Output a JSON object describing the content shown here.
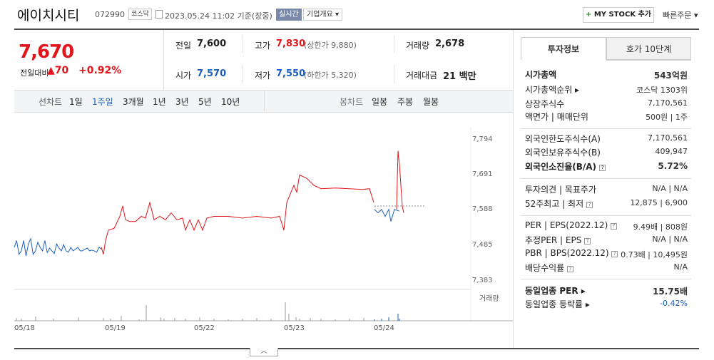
{
  "header": {
    "company_name": "에이치시티",
    "code": "072990",
    "market": "코스닥",
    "datetime": "2023.05.24 11:02 기준(장중)",
    "live_label": "실시간",
    "corp_overview": "기업개요 ▾",
    "mystock_plus": "+",
    "mystock_label": "MY STOCK 추가",
    "quick_order": "빠른주문 ▾"
  },
  "price": {
    "current": "7,670",
    "change_label": "전일대비",
    "change_arrow": "▲",
    "change": "70",
    "change_pct": "+0.92%"
  },
  "stats": {
    "prev_label": "전일",
    "prev": "7,600",
    "high_label": "고가",
    "high": "7,830",
    "upper_limit": "(상한가 9,880)",
    "volume_label": "거래량",
    "volume": "2,678",
    "open_label": "시가",
    "open": "7,570",
    "low_label": "저가",
    "low": "7,550",
    "lower_limit": "(하한가 5,320)",
    "amount_label": "거래대금",
    "amount": "21 백만"
  },
  "period_bar": {
    "line_label": "선차트",
    "line_items": [
      "1일",
      "1주일",
      "3개월",
      "1년",
      "3년",
      "5년",
      "10년"
    ],
    "active": "1주일",
    "candle_label": "봉차트",
    "candle_items": [
      "일봉",
      "주봉",
      "월봉"
    ]
  },
  "chart_data": {
    "type": "line",
    "yticks": [
      "7,794",
      "7,691",
      "7,588",
      "7,485",
      "7,383"
    ],
    "ylim": [
      7383,
      7794
    ],
    "xticks": [
      "05/18",
      "05/19",
      "05/22",
      "05/23",
      "05/24"
    ],
    "reference_price": 7600,
    "volume_legend": "거래량",
    "series": [
      {
        "color": "#e0161c",
        "values": []
      },
      {
        "color": "#1d5fbd",
        "values": []
      }
    ]
  },
  "right_panel": {
    "tab_info": "투자정보",
    "tab_hoga": "호가 10단계",
    "rows": [
      {
        "label": "시가총액",
        "value": "543억원",
        "bold": true
      },
      {
        "label": "시가총액순위 ▸",
        "value": "코스닥 1303위"
      },
      {
        "label": "상장주식수",
        "value": "7,170,561"
      },
      {
        "label": "액면가 | 매매단위",
        "value": "500원 | 1주"
      },
      {
        "label": "외국인한도주식수(A)",
        "value": "7,170,561"
      },
      {
        "label": "외국인보유주식수(B)",
        "value": "409,947"
      },
      {
        "label": "외국인소진율(B/A)",
        "value": "5.72%",
        "bold": true,
        "q": true
      },
      {
        "label": "투자의견 | 목표주가",
        "value": "N/A | N/A"
      },
      {
        "label": "52주최고 | 최저",
        "value": "12,875 | 6,900",
        "q": true
      },
      {
        "label": "PER | EPS(2022.12)",
        "value": "9.49배 | 808원",
        "q": true
      },
      {
        "label": "추정PER | EPS",
        "value": "N/A | N/A",
        "q": true
      },
      {
        "label": "PBR | BPS(2022.12)",
        "value": "0.73배 | 10,495원",
        "q": true
      },
      {
        "label": "배당수익률",
        "value": "N/A",
        "q": true
      },
      {
        "label": "동일업종 PER ▸",
        "value": "15.75배",
        "bold": true
      },
      {
        "label": "동일업종 등락률 ▸",
        "value": "-0.42%",
        "blue": true
      }
    ]
  },
  "scroll_toggle": "︿"
}
